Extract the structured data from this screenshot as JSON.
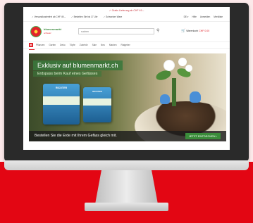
{
  "screen": {
    "topbar_text": "✓ Gratis Lieferung ab CHF 49.–",
    "util_left": [
      "✓ Versandkostenfrei ab CHF 49.–",
      "✓ Bestellen Sie bis 17 Uhr",
      "✓ Schweizer Ware"
    ],
    "util_right": [
      "DE ▾",
      "Hilfe",
      "Anmelden",
      "Merkliste"
    ],
    "logo_text": "blumenmarkt",
    "logo_sub": "schweiz",
    "search_placeholder": "suchen",
    "cart_label": "Warenkorb",
    "cart_amount": "CHF 0.00",
    "nav_home_icon": "■",
    "nav_items": [
      "Pflanzen",
      "Garten",
      "Deko",
      "Töpfe",
      "Zubehör",
      "Sale",
      "Neu",
      "Marken",
      "Ratgeber"
    ],
    "hero": {
      "headline": "Exklusiv auf blumenmarkt.ch",
      "subline": "Erdspass beim Kauf eines Gefässes",
      "bag_brand": "RICOTER",
      "cta_text": "Bestellen Sie die Erde mit Ihrem Gefäss gleich mit.",
      "cta_button": "JETZT ENTDECKEN ›"
    }
  },
  "colors": {
    "brand_red": "#e30613",
    "brand_green": "#3a8c3a",
    "hero_bg": "#6b7441"
  }
}
